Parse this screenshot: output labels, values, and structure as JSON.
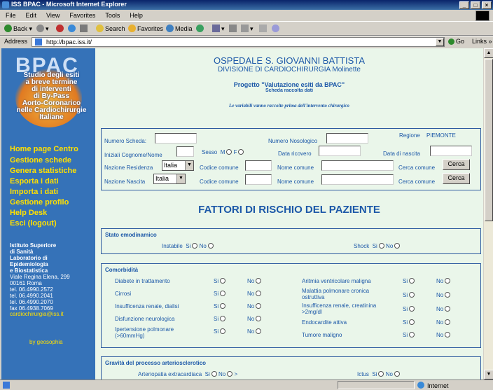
{
  "window": {
    "title": "ISS BPAC - Microsoft Internet Explorer"
  },
  "menu": [
    "File",
    "Edit",
    "View",
    "Favorites",
    "Tools",
    "Help"
  ],
  "toolbar": {
    "back": "Back",
    "search": "Search",
    "favorites": "Favorites",
    "media": "Media"
  },
  "address": {
    "label": "Address",
    "url": "http://bpac.iss.it/",
    "go": "Go",
    "links": "Links"
  },
  "sidebar": {
    "logo": "BPAC",
    "tagline": [
      "Studio degli esiti",
      "a breve termine",
      "di interventi",
      "di By-Pass",
      "Aorto-Coronarico",
      "nelle Cardiochirurgie",
      "Italiane"
    ],
    "nav": [
      "Home page Centro",
      "Gestione schede",
      "Genera statistiche",
      "Esporta i dati",
      "Importa i dati",
      "Gestione profilo",
      "Help Desk",
      "Esci (logout)"
    ],
    "org": [
      "Istituto Superiore",
      "di Sanità",
      "Laboratorio di",
      "Epidemiologia",
      "e Biostatistica"
    ],
    "addr": [
      "Viale Regina Elena, 299",
      "00161 Roma",
      "tel. 06.4990.2572",
      "tel. 06.4990.2041",
      "tel. 06.4990.2070",
      "fax 06.4938.7069"
    ],
    "email": "cardiochirurgia@iss.it",
    "credit": "by geosophia"
  },
  "header": {
    "hospital": "OSPEDALE S. GIOVANNI BATTISTA",
    "division": "DIVISIONE DI CARDIOCHIRURGIA Molinette",
    "project": "Progetto \"Valutazione esiti da BPAC\"",
    "subtitle": "Scheda raccolta dati",
    "note": "Le variabili vanno raccolte prima dell'intervento chirurgico"
  },
  "form": {
    "numero_scheda": "Numero Scheda:",
    "numero_nosologico": "Numero Nosologico",
    "regione": "Regione",
    "regione_val": "PIEMONTE",
    "iniziali": "Iniziali Cognome/Nome",
    "sesso": "Sesso",
    "m": "M",
    "f": "F",
    "data_ricovero": "Data ricovero",
    "data_nascita": "Data di nascita",
    "nazione_residenza": "Nazione Residenza",
    "nazione_nascita": "Nazione Nascita",
    "nazione_val": "Italia",
    "codice_comune": "Codice comune",
    "nome_comune": "Nome comune",
    "cerca_comune": "Cerca comune",
    "cerca_btn": "Cerca"
  },
  "fattori": {
    "title": "FATTORI DI RISCHIO DEL PAZIENTE"
  },
  "sections": {
    "emo": "Stato emodinamico",
    "instabile": "Instabile",
    "shock": "Shock",
    "si": "Si",
    "no": "No",
    "comorb": "Comorbidità",
    "left": [
      "Diabete in trattamento",
      "Cirrosi",
      "Insufficenza renale, dialisi",
      "Disfunzione neurologica",
      "Ipertensione polmonare (>60mmHg)"
    ],
    "right": [
      "Aritmia ventricolare maligna",
      "Malattia polmonare cronica ostruttiva",
      "Insufficenza renale, creatinina >2mg/dl",
      "Endocardite attiva",
      "Tumore maligno"
    ],
    "grav": "Gravità del processo arteriosclerotico",
    "arterio": "Arteriopatia extracardiaca",
    "gt": ">",
    "ictus": "Ictus"
  },
  "status": {
    "zone": "Internet"
  }
}
